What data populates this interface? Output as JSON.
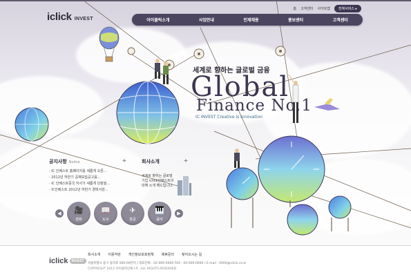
{
  "header": {
    "logo_main": "iclick",
    "logo_sub": "INVEST",
    "util_links": [
      "홈",
      "고객센터",
      "사이트맵"
    ],
    "all_services": "전체서비스 ▸"
  },
  "gnb": {
    "items": [
      "아이클릭소개",
      "사업안내",
      "인재채용",
      "홍보센터",
      "고객센터"
    ]
  },
  "hero": {
    "tagline": "세계로 향하는 글로벌 금융",
    "title_line1": "Global",
    "title_line2": "Finance No.1",
    "subtitle": "IC INVEST Creative is Innovation"
  },
  "notice": {
    "title": "공지사항",
    "title_en": "Notice",
    "more": "+",
    "items": [
      "IC 인베스트 홈페이지를 새롭게 오픈...",
      "2012년 하반기 공채모집공고를...",
      "IC 인베스트중국 지사가 새롭게 단장을...",
      "IC인베스트 2012년 하반기 경력사원..."
    ]
  },
  "company": {
    "title": "회사소개",
    "more": "+",
    "text": [
      "세계로 향하는 글로벌",
      "기업 iclick인베스트의",
      "대해 소개 해드립니다."
    ]
  },
  "quick": {
    "prev": "◀",
    "next": "▶",
    "items": [
      {
        "label": "영화",
        "icon": "film-camera-icon",
        "glyph": "🎥"
      },
      {
        "label": "도서",
        "icon": "book-icon",
        "glyph": "📖"
      },
      {
        "label": "항공",
        "icon": "airplane-icon",
        "glyph": "✈"
      },
      {
        "label": "음악",
        "icon": "piano-icon",
        "glyph": "🎹"
      }
    ]
  },
  "footer": {
    "logo_main": "iclick",
    "logo_sub": "INVEST",
    "links": [
      "회사소개",
      "이용약관",
      "개인정보보호정책",
      "제휴문의",
      "찾아오시는 길"
    ],
    "address": "서울특별시 중구 을지로 000-00번지  /  대표전화 : 02-000-0000  FAX : 00-000-0000  /  E-mail : 0000@iclick.co.kr",
    "copyright": "COPYRIGHT 2012 아이클릭인베스트. ALL RIGHTS RESERVED"
  },
  "colors": {
    "nav_bg": "#4b4560",
    "title_text": "#3d3650",
    "button_gray": "#8f8a98"
  }
}
